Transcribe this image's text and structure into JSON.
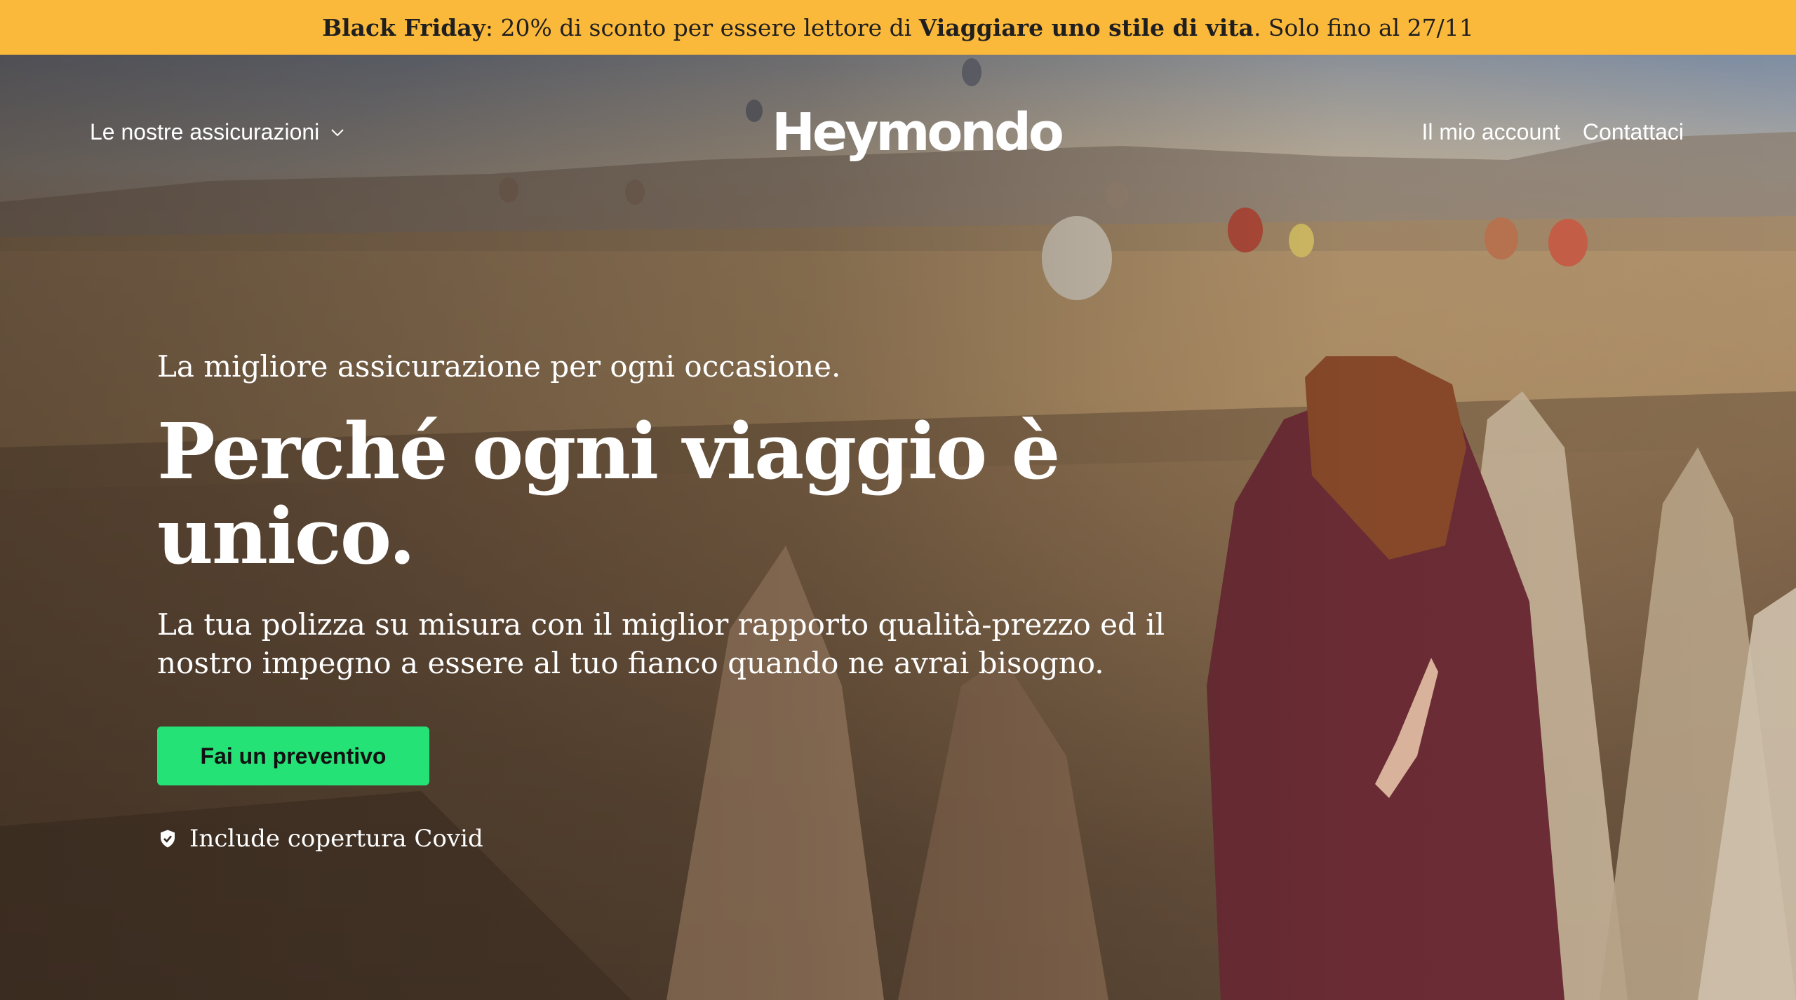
{
  "promo": {
    "part1_bold": "Black Friday",
    "part2": ": 20% di sconto per essere lettore di ",
    "part3_bold": "Viaggiare uno stile di vita",
    "part4": ". Solo fino al 27/11"
  },
  "nav": {
    "insurance_menu": "Le nostre assicurazioni",
    "logo": "Heymondo",
    "account": "Il mio account",
    "contact": "Contattaci"
  },
  "hero": {
    "kicker": "La migliore assicurazione per ogni occasione.",
    "headline": "Perché ogni viaggio è unico.",
    "subtitle": "La tua polizza su misura con il miglior rapporto qualità-prezzo ed il nostro impegno a essere al tuo fianco quando ne avrai bisogno.",
    "cta": "Fai un preventivo",
    "covid": "Include copertura Covid"
  },
  "colors": {
    "promo_bg": "#fbb93c",
    "cta_bg": "#25e276"
  },
  "icons": {
    "menu_chevron": "chevron-down-icon",
    "covid_badge": "shield-check-icon"
  }
}
